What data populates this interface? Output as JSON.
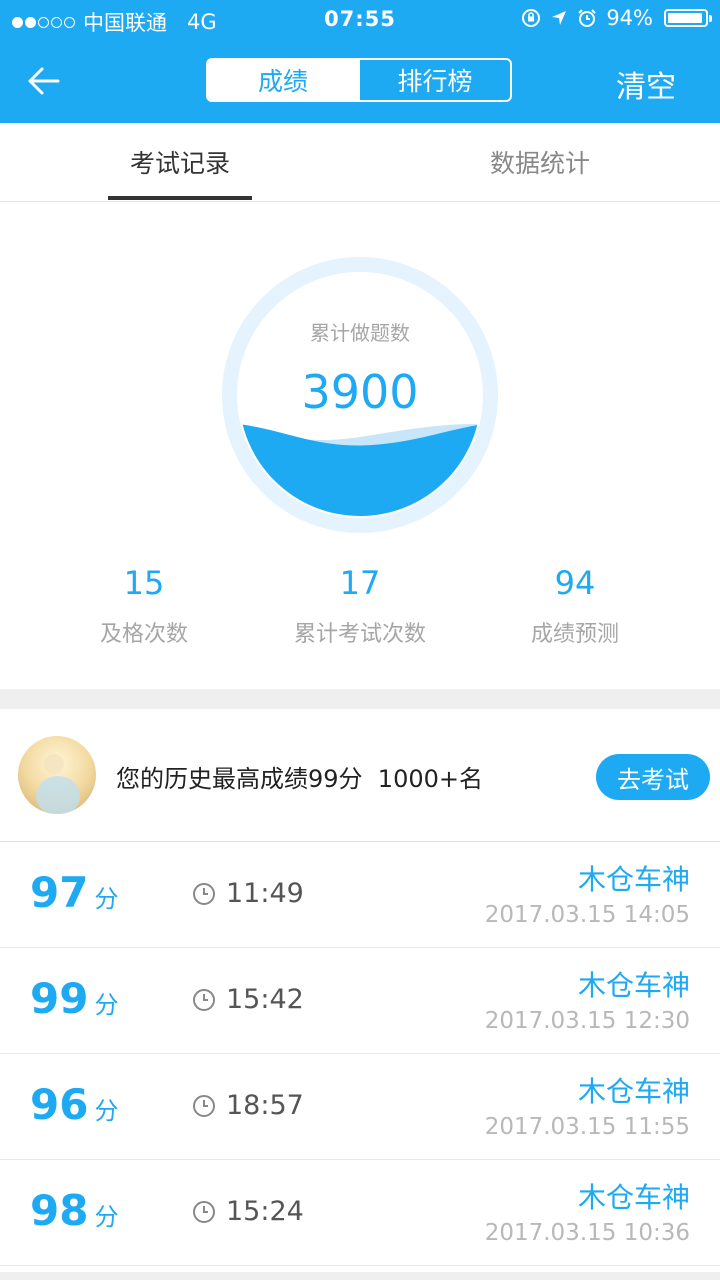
{
  "status_bar": {
    "carrier": "中国联通",
    "network": "4G",
    "time": "07:55",
    "battery": "94%",
    "battery_level": 0.94
  },
  "nav": {
    "segments": [
      "成绩",
      "排行榜"
    ],
    "active_segment": 0,
    "clear_label": "清空"
  },
  "tabs": {
    "items": [
      "考试记录",
      "数据统计"
    ],
    "active": 0
  },
  "gauge": {
    "label": "累计做题数",
    "value": "3900"
  },
  "stats": [
    {
      "value": "15",
      "label": "及格次数"
    },
    {
      "value": "17",
      "label": "累计考试次数"
    },
    {
      "value": "94",
      "label": "成绩预测"
    }
  ],
  "best": {
    "text": "您的历史最高成绩99分  1000+名",
    "button": "去考试"
  },
  "records": [
    {
      "score": "97",
      "unit": "分",
      "duration": "11:49",
      "user": "木仓车神",
      "date": "2017.03.15 14:05"
    },
    {
      "score": "99",
      "unit": "分",
      "duration": "15:42",
      "user": "木仓车神",
      "date": "2017.03.15 12:30"
    },
    {
      "score": "96",
      "unit": "分",
      "duration": "18:57",
      "user": "木仓车神",
      "date": "2017.03.15 11:55"
    },
    {
      "score": "98",
      "unit": "分",
      "duration": "15:24",
      "user": "木仓车神",
      "date": "2017.03.15 10:36"
    }
  ],
  "colors": {
    "primary": "#1ea9f3",
    "text_dark": "#222222",
    "text_gray": "#a6a6a6"
  }
}
